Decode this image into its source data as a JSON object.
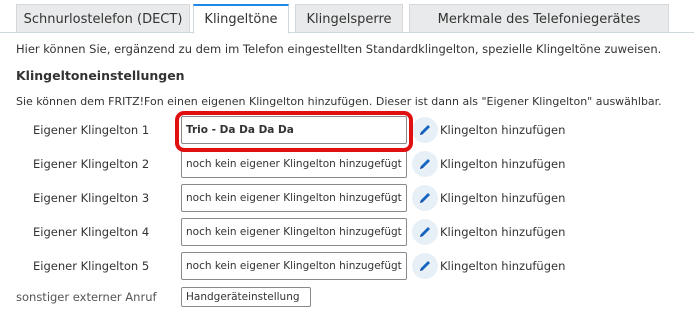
{
  "tabs": [
    {
      "label": "Schnurlostelefon (DECT)",
      "active": false
    },
    {
      "label": "Klingeltöne",
      "active": true
    },
    {
      "label": "Klingelsperre",
      "active": false
    },
    {
      "label": "Merkmale des Telefoniegerätes",
      "active": false
    }
  ],
  "intro": "Hier können Sie, ergänzend zu dem im Telefon eingestellten Standardklingelton, spezielle Klingeltöne zuweisen.",
  "section_title": "Klingeltoneinstellungen",
  "description": "Sie können dem FRITZ!Fon einen eigenen Klingelton hinzufügen. Dieser ist dann als \"Eigener Klingelton\" auswählbar.",
  "ringtones": [
    {
      "label": "Eigener Klingelton 1",
      "value": "Trio - Da Da Da Da",
      "action": "Klingelton hinzufügen"
    },
    {
      "label": "Eigener Klingelton 2",
      "value": "noch kein eigener Klingelton hinzugefügt",
      "action": "Klingelton hinzufügen"
    },
    {
      "label": "Eigener Klingelton 3",
      "value": "noch kein eigener Klingelton hinzugefügt",
      "action": "Klingelton hinzufügen"
    },
    {
      "label": "Eigener Klingelton 4",
      "value": "noch kein eigener Klingelton hinzugefügt",
      "action": "Klingelton hinzufügen"
    },
    {
      "label": "Eigener Klingelton 5",
      "value": "noch kein eigener Klingelton hinzugefügt",
      "action": "Klingelton hinzufügen"
    }
  ],
  "bottom_row": {
    "label": "sonstiger externer Anruf",
    "value": "Handgeräteinstellung"
  },
  "colors": {
    "accent": "#1e88e5",
    "highlight": "#e01010",
    "edit_icon": "#1565c0"
  }
}
